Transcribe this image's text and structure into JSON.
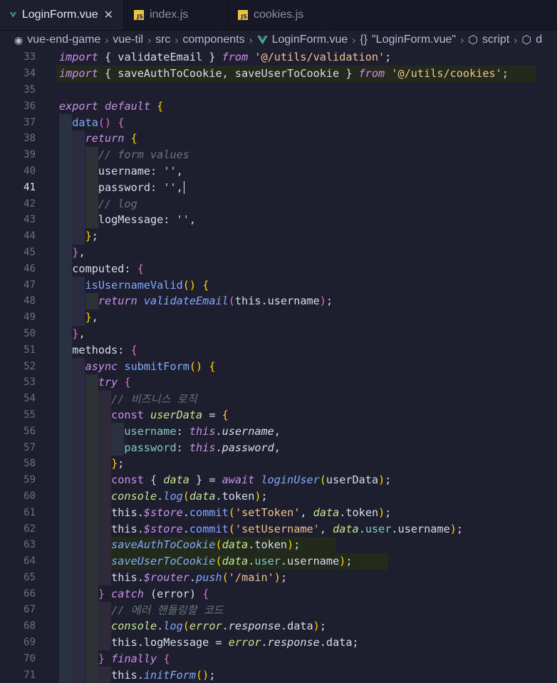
{
  "tabs": [
    {
      "label": "LoginForm.vue",
      "icon": "vue-icon",
      "active": true
    },
    {
      "label": "index.js",
      "icon": "js-icon",
      "active": false
    },
    {
      "label": "cookies.js",
      "icon": "js-icon",
      "active": false
    }
  ],
  "breadcrumb": [
    "vue-end-game",
    "vue-til",
    "src",
    "components",
    "LoginForm.vue",
    "\"LoginForm.vue\"",
    "script",
    "d"
  ],
  "current_line": 41,
  "colors": {
    "accent_vue": "#41b883",
    "js_icon": "#e8c547",
    "line_highlight": "#232a1c"
  },
  "lines": [
    {
      "n": "33",
      "t": [
        [
          "kw",
          "import"
        ],
        [
          "key",
          " { validateEmail } "
        ],
        [
          "kw",
          "from"
        ],
        [
          "str",
          " '@/utils/validation'"
        ],
        [
          "key",
          ";"
        ]
      ]
    },
    {
      "n": "34",
      "t": [
        [
          "kw",
          "import"
        ],
        [
          "key",
          " { saveAuthToCookie, saveUserToCookie } "
        ],
        [
          "kw",
          "from"
        ],
        [
          "str",
          " '@/utils/cookies'"
        ],
        [
          "key",
          ";"
        ]
      ]
    },
    {
      "n": "35",
      "t": []
    },
    {
      "n": "36",
      "t": [
        [
          "kw",
          "export"
        ],
        [
          "kw",
          " default"
        ],
        [
          "brace",
          " {"
        ]
      ]
    },
    {
      "n": "37",
      "t": [
        [
          "fn2",
          "  data"
        ],
        [
          "brace2",
          "()"
        ],
        [
          "key",
          " "
        ],
        [
          "brace2",
          "{"
        ]
      ]
    },
    {
      "n": "38",
      "t": [
        [
          "kw",
          "    return"
        ],
        [
          "key",
          " "
        ],
        [
          "brace",
          "{"
        ]
      ]
    },
    {
      "n": "39",
      "t": [
        [
          "cm",
          "      // form values"
        ]
      ]
    },
    {
      "n": "40",
      "t": [
        [
          "key",
          "      username: "
        ],
        [
          "str",
          "''"
        ],
        [
          "key",
          ","
        ]
      ]
    },
    {
      "n": "41",
      "t": [
        [
          "key",
          "      password: "
        ],
        [
          "str",
          "''"
        ],
        [
          "key",
          ","
        ]
      ]
    },
    {
      "n": "42",
      "t": [
        [
          "cm",
          "      // log"
        ]
      ]
    },
    {
      "n": "43",
      "t": [
        [
          "key",
          "      logMessage: "
        ],
        [
          "str",
          "''"
        ],
        [
          "key",
          ","
        ]
      ]
    },
    {
      "n": "44",
      "t": [
        [
          "brace",
          "    }"
        ],
        [
          "key",
          ";"
        ]
      ]
    },
    {
      "n": "45",
      "t": [
        [
          "brace2",
          "  }"
        ],
        [
          "key",
          ","
        ]
      ]
    },
    {
      "n": "46",
      "t": [
        [
          "key",
          "  computed: "
        ],
        [
          "brace2",
          "{"
        ]
      ]
    },
    {
      "n": "47",
      "t": [
        [
          "fn2",
          "    isUsernameValid"
        ],
        [
          "brace",
          "()"
        ],
        [
          "key",
          " "
        ],
        [
          "brace",
          "{"
        ]
      ]
    },
    {
      "n": "48",
      "t": [
        [
          "kw",
          "      return"
        ],
        [
          "fn",
          " validateEmail"
        ],
        [
          "brace2",
          "("
        ],
        [
          "key",
          "this.username"
        ],
        [
          "brace2",
          ")"
        ],
        [
          "key",
          ";"
        ]
      ]
    },
    {
      "n": "49",
      "t": [
        [
          "brace",
          "    }"
        ],
        [
          "key",
          ","
        ]
      ]
    },
    {
      "n": "50",
      "t": [
        [
          "brace2",
          "  }"
        ],
        [
          "key",
          ","
        ]
      ]
    },
    {
      "n": "51",
      "t": [
        [
          "key",
          "  methods: "
        ],
        [
          "brace2",
          "{"
        ]
      ]
    },
    {
      "n": "52",
      "t": [
        [
          "kw",
          "    async"
        ],
        [
          "fn2",
          " submitForm"
        ],
        [
          "brace",
          "()"
        ],
        [
          "key",
          " "
        ],
        [
          "brace",
          "{"
        ]
      ]
    },
    {
      "n": "53",
      "t": [
        [
          "kw",
          "      try"
        ],
        [
          "key",
          " "
        ],
        [
          "brace2",
          "{"
        ]
      ]
    },
    {
      "n": "54",
      "t": [
        [
          "cm",
          "        // 비즈니스 로직"
        ]
      ]
    },
    {
      "n": "55",
      "t": [
        [
          "kw2",
          "        const"
        ],
        [
          "var",
          " userData"
        ],
        [
          "key",
          " = "
        ],
        [
          "brace",
          "{"
        ]
      ]
    },
    {
      "n": "56",
      "t": [
        [
          "prop",
          "          username"
        ],
        [
          "key",
          ": "
        ],
        [
          "kw",
          "this"
        ],
        [
          "key",
          "."
        ],
        [
          "ital",
          "username"
        ],
        [
          "key",
          ","
        ]
      ]
    },
    {
      "n": "57",
      "t": [
        [
          "prop",
          "          password"
        ],
        [
          "key",
          ": "
        ],
        [
          "kw",
          "this"
        ],
        [
          "key",
          "."
        ],
        [
          "ital",
          "password"
        ],
        [
          "key",
          ","
        ]
      ]
    },
    {
      "n": "58",
      "t": [
        [
          "brace",
          "        }"
        ],
        [
          "key",
          ";"
        ]
      ]
    },
    {
      "n": "59",
      "t": [
        [
          "kw2",
          "        const"
        ],
        [
          "key",
          " { "
        ],
        [
          "var",
          "data"
        ],
        [
          "key",
          " } = "
        ],
        [
          "kw",
          "await"
        ],
        [
          "fn",
          " loginUser"
        ],
        [
          "brace",
          "("
        ],
        [
          "key",
          "userData"
        ],
        [
          "brace",
          ")"
        ],
        [
          "key",
          ";"
        ]
      ]
    },
    {
      "n": "60",
      "t": [
        [
          "var",
          "        console"
        ],
        [
          "key",
          "."
        ],
        [
          "fn",
          "log"
        ],
        [
          "brace",
          "("
        ],
        [
          "var",
          "data"
        ],
        [
          "key",
          ".token"
        ],
        [
          "brace",
          ")"
        ],
        [
          "key",
          ";"
        ]
      ]
    },
    {
      "n": "61",
      "t": [
        [
          "key",
          "        this."
        ],
        [
          "kw",
          "$store"
        ],
        [
          "key",
          "."
        ],
        [
          "fn2",
          "commit"
        ],
        [
          "brace",
          "("
        ],
        [
          "str",
          "'setToken'"
        ],
        [
          "key",
          ", "
        ],
        [
          "var",
          "data"
        ],
        [
          "key",
          ".token"
        ],
        [
          "brace",
          ")"
        ],
        [
          "key",
          ";"
        ]
      ]
    },
    {
      "n": "62",
      "t": [
        [
          "key",
          "        this."
        ],
        [
          "kw",
          "$store"
        ],
        [
          "key",
          "."
        ],
        [
          "fn2",
          "commit"
        ],
        [
          "brace",
          "("
        ],
        [
          "str",
          "'setUsername'"
        ],
        [
          "key",
          ", "
        ],
        [
          "var",
          "data"
        ],
        [
          "key",
          "."
        ],
        [
          "prop",
          "user"
        ],
        [
          "key",
          ".username"
        ],
        [
          "brace",
          ")"
        ],
        [
          "key",
          ";"
        ]
      ]
    },
    {
      "n": "63",
      "t": [
        [
          "fn",
          "        saveAuthToCookie"
        ],
        [
          "brace",
          "("
        ],
        [
          "var",
          "data"
        ],
        [
          "key",
          ".token"
        ],
        [
          "brace",
          ")"
        ],
        [
          "key",
          ";"
        ]
      ]
    },
    {
      "n": "64",
      "t": [
        [
          "fn",
          "        saveUserToCookie"
        ],
        [
          "brace",
          "("
        ],
        [
          "var",
          "data"
        ],
        [
          "key",
          "."
        ],
        [
          "prop",
          "user"
        ],
        [
          "key",
          ".username"
        ],
        [
          "brace",
          ")"
        ],
        [
          "key",
          ";"
        ]
      ]
    },
    {
      "n": "65",
      "t": [
        [
          "key",
          "        this."
        ],
        [
          "kw",
          "$router"
        ],
        [
          "key",
          "."
        ],
        [
          "fn",
          "push"
        ],
        [
          "brace",
          "("
        ],
        [
          "str",
          "'/main'"
        ],
        [
          "brace",
          ")"
        ],
        [
          "key",
          ";"
        ]
      ]
    },
    {
      "n": "66",
      "t": [
        [
          "brace2",
          "      }"
        ],
        [
          "kw",
          " catch"
        ],
        [
          "key",
          " (error) "
        ],
        [
          "brace2",
          "{"
        ]
      ]
    },
    {
      "n": "67",
      "t": [
        [
          "cm",
          "        // 에러 핸들링할 코드"
        ]
      ]
    },
    {
      "n": "68",
      "t": [
        [
          "var",
          "        console"
        ],
        [
          "key",
          "."
        ],
        [
          "fn",
          "log"
        ],
        [
          "brace",
          "("
        ],
        [
          "var",
          "error"
        ],
        [
          "key",
          "."
        ],
        [
          "ital",
          "response"
        ],
        [
          "key",
          ".data"
        ],
        [
          "brace",
          ")"
        ],
        [
          "key",
          ";"
        ]
      ]
    },
    {
      "n": "69",
      "t": [
        [
          "key",
          "        this.logMessage = "
        ],
        [
          "var",
          "error"
        ],
        [
          "key",
          "."
        ],
        [
          "ital",
          "response"
        ],
        [
          "key",
          ".data;"
        ]
      ]
    },
    {
      "n": "70",
      "t": [
        [
          "brace2",
          "      }"
        ],
        [
          "kw",
          " finally"
        ],
        [
          "key",
          " "
        ],
        [
          "brace2",
          "{"
        ]
      ]
    },
    {
      "n": "71",
      "t": [
        [
          "key",
          "        this."
        ],
        [
          "fn",
          "initForm"
        ],
        [
          "brace",
          "()"
        ],
        [
          "key",
          ";"
        ]
      ]
    }
  ]
}
